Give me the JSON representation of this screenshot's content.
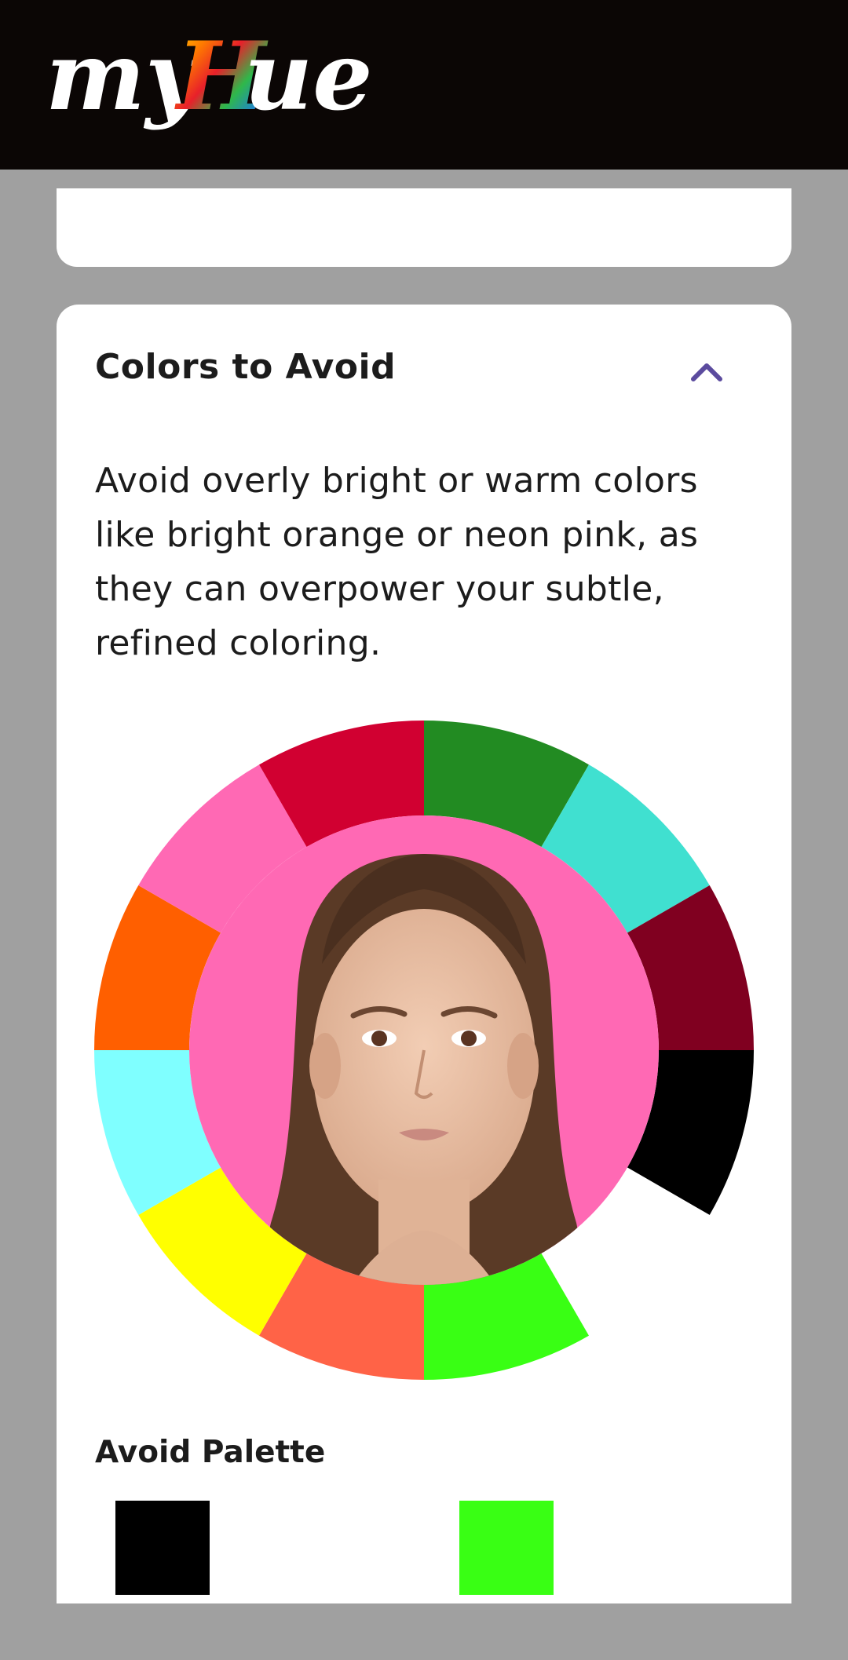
{
  "app": {
    "logo_text_my": "my",
    "logo_text_h": "H",
    "logo_text_ue": "ue"
  },
  "section": {
    "title": "Colors to Avoid",
    "toggle_icon": "chevron-up-icon",
    "description": "Avoid overly bright or warm colors like bright orange or neon pink, as they can overpower your subtle, refined coloring.",
    "center_color": "#ff69b4",
    "wheel_colors": [
      "#228b22",
      "#40e0d0",
      "#800020",
      "#000000",
      "#ffffff",
      "#39ff14",
      "#ff6347",
      "#ffff00",
      "#7fffff",
      "#ff5f00",
      "#ff69b4",
      "#d10031"
    ]
  },
  "palette": {
    "title": "Avoid Palette",
    "swatches": [
      {
        "color": "#000000"
      },
      {
        "color": "#39ff14"
      }
    ]
  },
  "colors": {
    "header_bg": "#0b0605",
    "page_bg": "#a0a0a0",
    "accent": "#5b4b9e"
  }
}
